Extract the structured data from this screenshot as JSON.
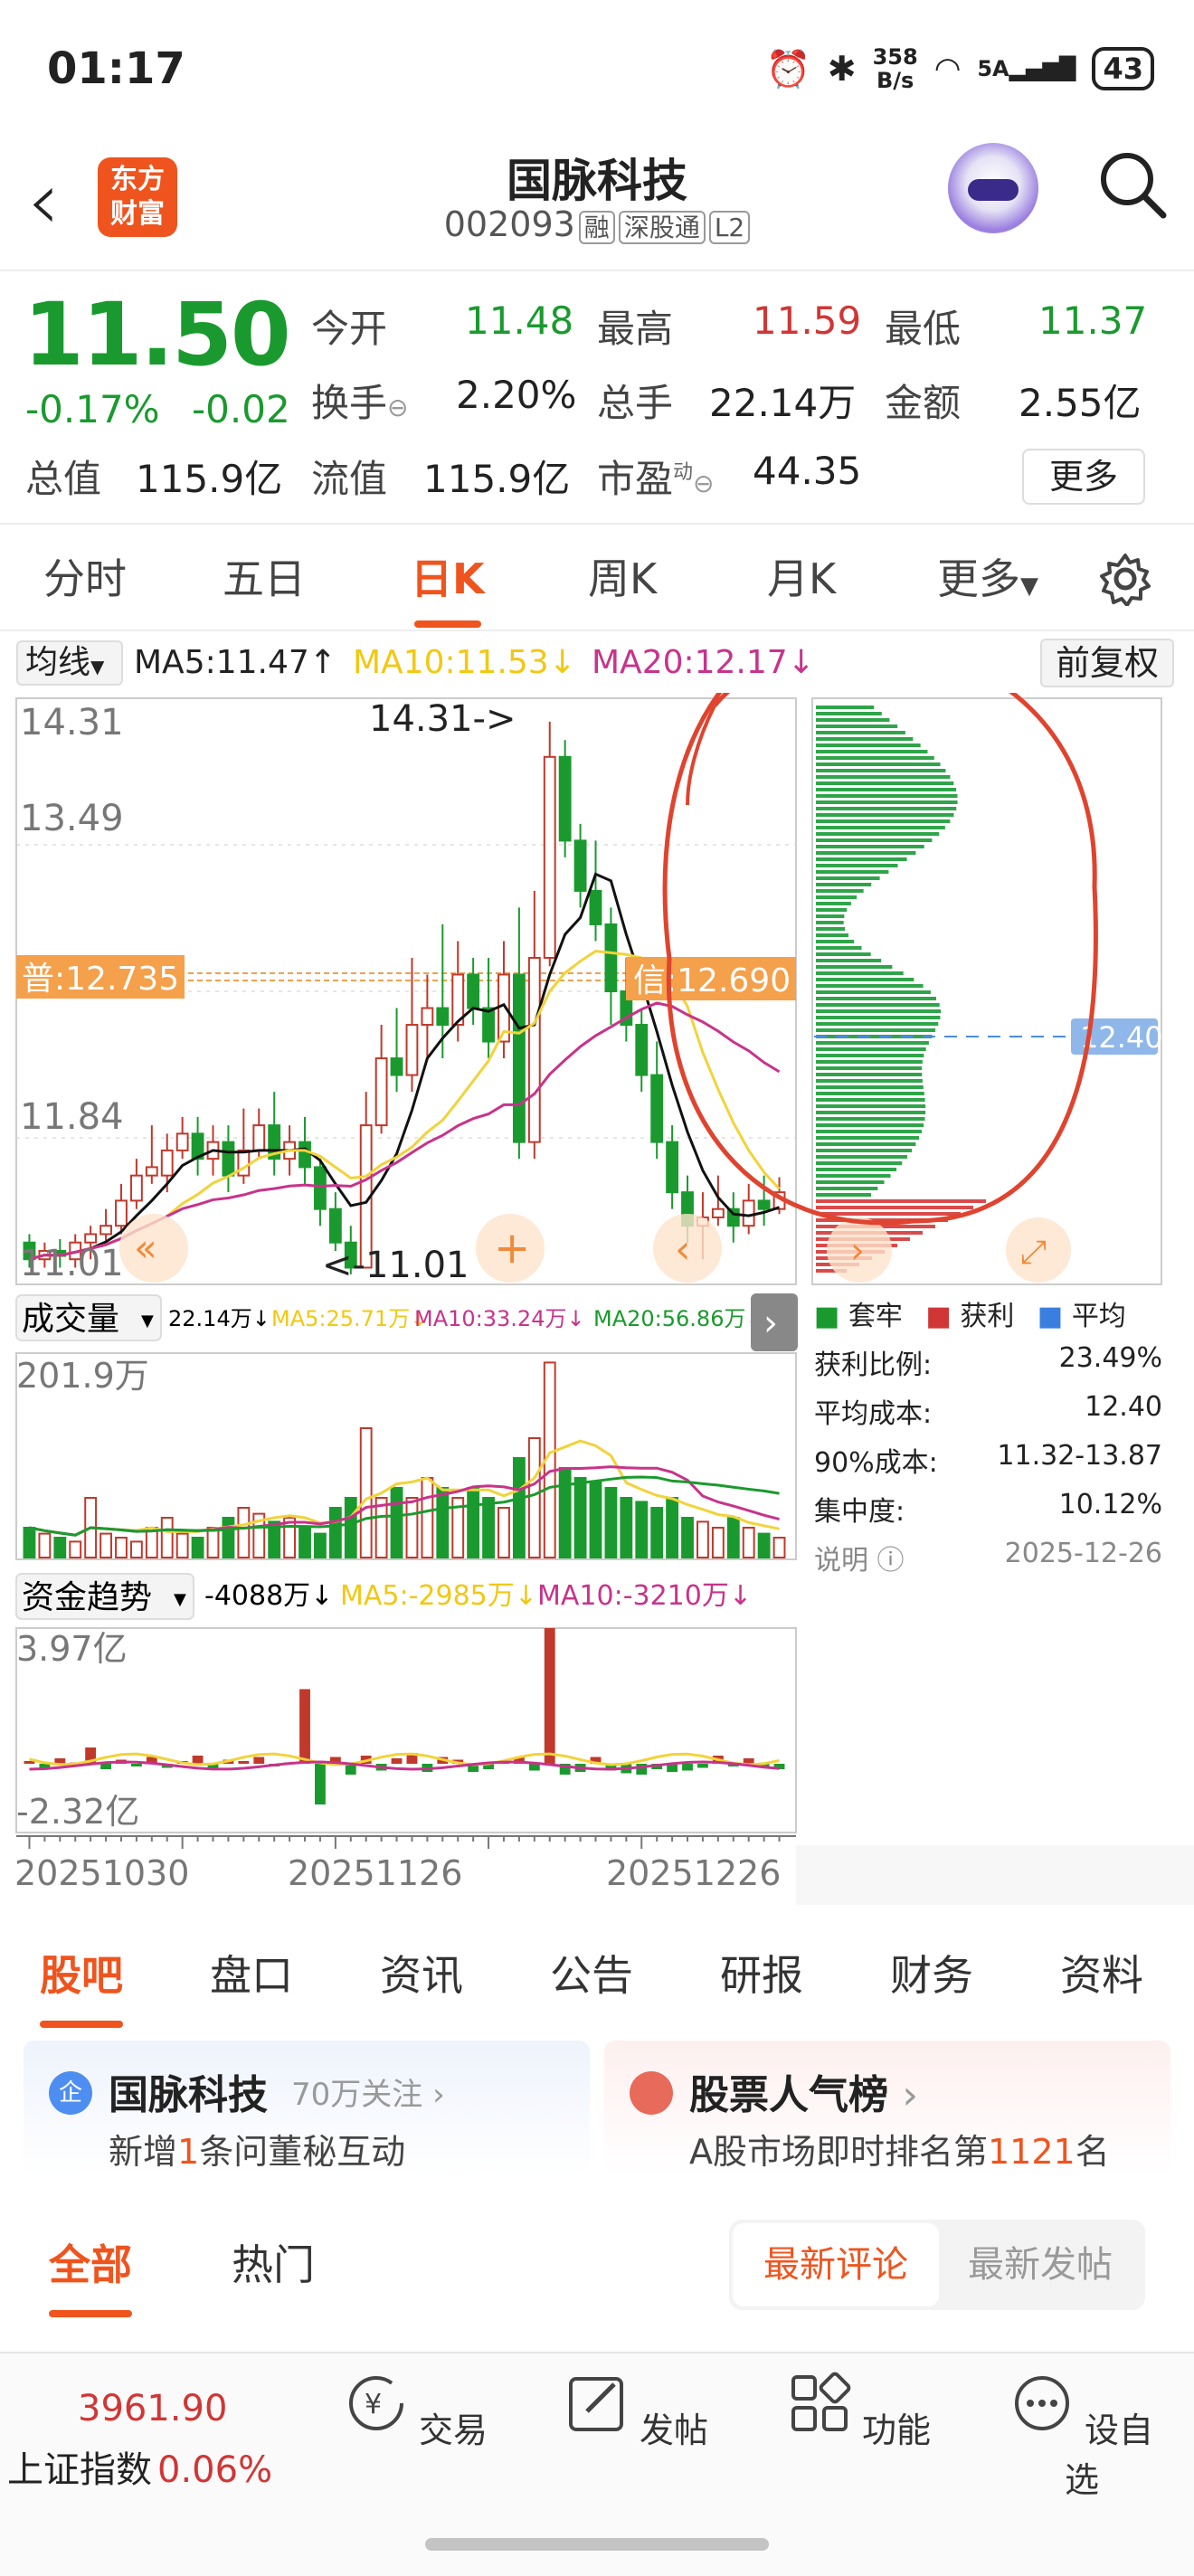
{
  "status_bar": {
    "time": "01:17",
    "net_speed_top": "358",
    "net_speed_unit": "B/s",
    "signal": "5A",
    "battery": "43"
  },
  "nav": {
    "back_icon": "chevron-left-icon",
    "logo": "东方\n财富",
    "title": "国脉科技",
    "code": "002093",
    "tags": [
      "融",
      "深股通",
      "L2"
    ]
  },
  "quote": {
    "price": "11.50",
    "change_pct": "-0.17%",
    "change": "-0.02",
    "open_label": "今开",
    "open": "11.48",
    "high_label": "最高",
    "high": "11.59",
    "low_label": "最低",
    "low": "11.37",
    "turnover_label": "换手",
    "turnover": "2.20%",
    "volume_label": "总手",
    "volume": "22.14万",
    "amount_label": "金额",
    "amount": "2.55亿",
    "mktcap_label": "总值",
    "mktcap": "115.9亿",
    "float_label": "流值",
    "float_cap": "115.9亿",
    "pe_label": "市盈",
    "pe_sup": "动",
    "pe": "44.35",
    "more": "更多",
    "colors": {
      "up": "#d03636",
      "down": "#1a9a2e",
      "accent": "#f0541e"
    }
  },
  "ktabs": [
    "分时",
    "五日",
    "日K",
    "周K",
    "月K",
    "更多"
  ],
  "ktabs_active": "日K",
  "ma": {
    "selector": "均线",
    "ma5": "MA5:11.47↑",
    "ma10": "MA10:11.53↓",
    "ma20": "MA20:12.17↓",
    "adjust": "前复权"
  },
  "kchart": {
    "top_price": "14.31",
    "p2": "13.49",
    "p3": "11.84",
    "bottom_price": "11.01",
    "max_marker": "14.31->",
    "min_marker": "<-11.01",
    "left_tag": "普:12.735",
    "right_tag": "信:12.690",
    "avg_tag": "12.40"
  },
  "volume": {
    "selector": "成交量",
    "value": "22.14万↓",
    "ma5": "MA5:25.71万↓",
    "ma10": "MA10:33.24万↓",
    "ma20": "MA20:56.86万↓",
    "max": "201.9万"
  },
  "fund": {
    "selector": "资金趋势",
    "value": "-4088万↓",
    "ma5": "MA5:-2985万↓",
    "ma10": "MA10:-3210万↓",
    "max": "3.97亿",
    "min": "-2.32亿"
  },
  "dates": [
    "20251030",
    "20251126",
    "20251226"
  ],
  "chip": {
    "legend": [
      "套牢",
      "获利",
      "平均"
    ],
    "profit_ratio_label": "获利比例:",
    "profit_ratio": "23.49%",
    "avg_cost_label": "平均成本:",
    "avg_cost": "12.40",
    "cost90_label": "90%成本:",
    "cost90": "11.32-13.87",
    "conc_label": "集中度:",
    "conc": "10.12%",
    "note": "说明",
    "date": "2025-12-26"
  },
  "section_tabs": [
    "股吧",
    "盘口",
    "资讯",
    "公告",
    "研报",
    "财务",
    "资料"
  ],
  "section_active": "股吧",
  "cards": {
    "left_title": "国脉科技",
    "left_follow": "70万关注",
    "left_sub_pre": "新增",
    "left_sub_num": "1",
    "left_sub_post": "条问董秘互动",
    "left_badge": "企",
    "right_title": "股票人气榜",
    "right_sub_pre": "A股市场即时排名第",
    "right_sub_num": "1121",
    "right_sub_post": "名"
  },
  "filter": {
    "all": "全部",
    "hot": "热门",
    "latest_comment": "最新评论",
    "latest_post": "最新发帖"
  },
  "bottom": {
    "index_value": "3961.90",
    "index_name": "上证指数",
    "index_change": "0.06%",
    "items": [
      "交易",
      "发帖",
      "功能",
      "设自选"
    ]
  }
}
